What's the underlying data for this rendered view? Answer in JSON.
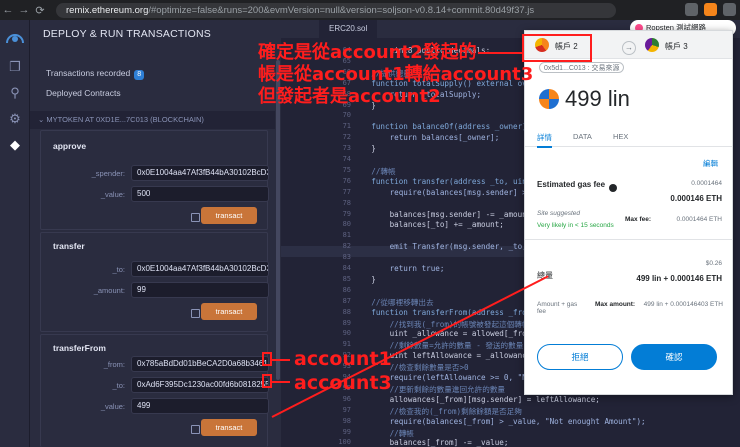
{
  "browser": {
    "url_host": "remix.ethereum.org",
    "url_rest": "/#optimize=false&runs=200&evmVersion=null&version=soljson-v0.8.14+commit.80d49f37.js"
  },
  "panel": {
    "title": "DEPLOY & RUN TRANSACTIONS",
    "transactions_recorded": "Transactions recorded",
    "transactions_count": "8",
    "deployed_contracts": "Deployed Contracts",
    "instance": "MYTOKEN AT 0XD1E...7C013 (BLOCKCHAIN)",
    "transact_label": "transact",
    "functions": [
      {
        "name": "approve",
        "params": [
          {
            "label": "_spender:",
            "value": "0x0E1004aa47Af3fB44bA30102BcD37"
          },
          {
            "label": "_value:",
            "value": "500"
          }
        ]
      },
      {
        "name": "transfer",
        "params": [
          {
            "label": "_to:",
            "value": "0x0E1004aa47Af3fB44bA30102BcD37"
          },
          {
            "label": "_amount:",
            "value": "99"
          }
        ]
      },
      {
        "name": "transferFrom",
        "params": [
          {
            "label": "_from:",
            "value": "0x785aBdDd01bBeCA2D0a68b3461F6"
          },
          {
            "label": "_to:",
            "value": "0xAd6F395Dc1230ac00fd6b08182553"
          },
          {
            "label": "_value:",
            "value": "499"
          }
        ]
      }
    ]
  },
  "editor": {
    "tab": "ERC20.sol",
    "line_numbers": [
      "64",
      "65",
      "66",
      "67",
      "68",
      "69",
      "70",
      "71",
      "72",
      "73",
      "74",
      "75",
      "76",
      "77",
      "78",
      "79",
      "80",
      "81",
      "82",
      "83",
      "84",
      "85",
      "86",
      "87",
      "88",
      "89",
      "90",
      "91",
      "92",
      "93",
      "94",
      "95",
      "96",
      "97",
      "98",
      "99",
      "100"
    ],
    "lines": [
      "        uint8 public decimals;",
      "",
      "    //提供總量",
      "    function totalSupply() external override",
      "        return _totalSupply;",
      "    }",
      "",
      "    function balanceOf(address _owner) exte",
      "        return balances[_owner];",
      "    }",
      "",
      "    //轉帳",
      "    function transfer(address _to, uint256",
      "        require(balances[msg.sender] > _amo",
      "",
      "        balances[msg.sender] -= _amount;",
      "        balances[_to] += _amount;",
      "",
      "        emit Transfer(msg.sender, _to, _amo",
      "",
      "        return true;",
      "    }",
      "",
      "    //從哪裡移轉出去",
      "    function transferFrom(address _from, a",
      "        //找到我(_from)的帳號被發起這個轉帳的",
      "        uint _allowance = allowed[_from][ms",
      "        //剩餘數量=允許的數量 - 發送的數量",
      "        uint leftAllowance = _allowance - _value;",
      "        //檢查剩餘數量是否>0",
      "        require(leftAllowance >= 0, \"Not enought allowance!\");",
      "        //更新剩餘的數量進回允許的數量",
      "        allowances[_from][msg.sender] = leftAllowance;",
      "        //檢查我的(_from)剩餘餘額是否足夠",
      "        require(balances[_from] > _value, \"Not enought Amount\");",
      "        //轉帳",
      "        balances[_from] -= _value;"
    ]
  },
  "metamask": {
    "network": "Ropsten 測試網路",
    "from_account": "帳戶 2",
    "to_account": "帳戶 3",
    "origin": "0x5d1...C013 : 交易來源",
    "amount": "499 lin",
    "tabs": [
      "詳情",
      "DATA",
      "HEX"
    ],
    "edit": "編輯",
    "gas_label": "Estimated gas fee",
    "gas_eth_small": "0.0001464",
    "gas_eth": "0.000146 ETH",
    "site_suggested": "Site suggested",
    "likely": "Very likely in < 15 seconds",
    "max_fee_label": "Max fee:",
    "max_fee_value": "0.0001464 ETH",
    "usd": "$0.26",
    "total_label": "總量",
    "total_value": "499 lin + 0.000146 ETH",
    "amount_gas_label": "Amount + gas fee",
    "max_amount_label": "Max amount:",
    "max_amount_value": "499 lin + 0.000146403 ETH",
    "reject": "拒絕",
    "confirm": "確認"
  },
  "annotations": {
    "line1": "確定是從account2發起的",
    "line2": "帳是從account1轉給account3",
    "line3": "但發起者是account2",
    "account1": "account1",
    "account3": "account3"
  },
  "colors": {
    "annotation": "#ff1d1d",
    "transact": "#c97539",
    "confirm": "#037dd6"
  }
}
